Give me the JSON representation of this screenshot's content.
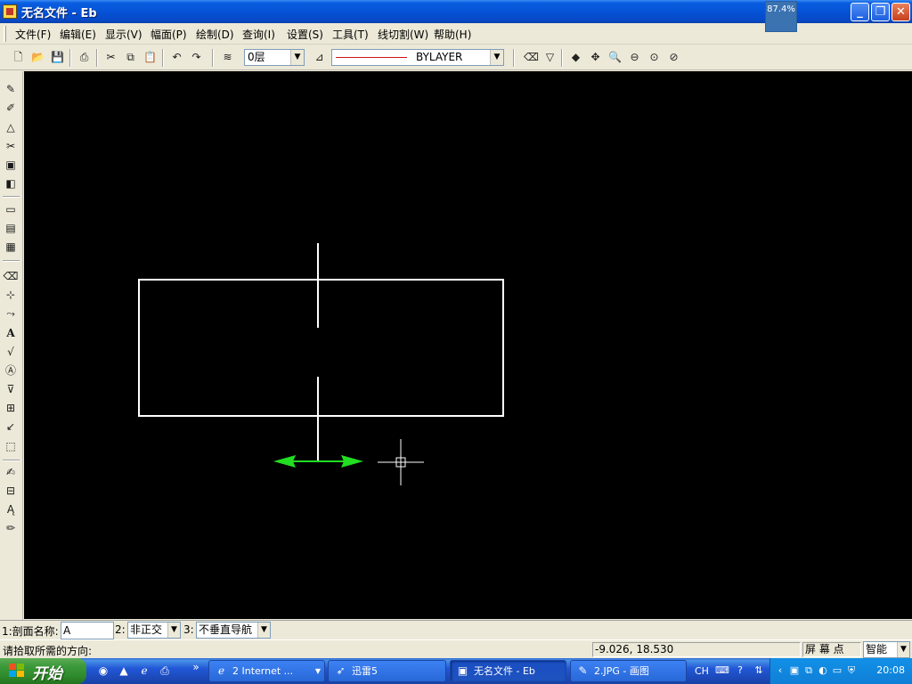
{
  "window": {
    "title": "无名文件 - Eb",
    "zoom_overlay": "87.4%"
  },
  "menu": [
    {
      "label": "文件(F)"
    },
    {
      "label": "编辑(E)"
    },
    {
      "label": "显示(V)"
    },
    {
      "label": "幅面(P)"
    },
    {
      "label": "绘制(D)"
    },
    {
      "label": "查询(I)"
    },
    {
      "label": "设置(S)"
    },
    {
      "label": "工具(T)"
    },
    {
      "label": "线切割(W)"
    },
    {
      "label": "帮助(H)"
    }
  ],
  "toolbar": {
    "layer_value": "0层",
    "linetype_value": "BYLAYER",
    "linetype_color": "#d01010"
  },
  "command": {
    "field1_label": "1:剖面名称:",
    "field1_value": "A",
    "field2_label": "2:",
    "field2_value": "非正交",
    "field3_label": "3:",
    "field3_value": "不垂直导航"
  },
  "status": {
    "prompt": "请拾取所需的方向:",
    "coordinates": "-9.026, 18.530",
    "snap_mode": "屏 幕 点",
    "smart_mode": "智能"
  },
  "canvas": {
    "background": "#000000",
    "line_color": "#ffffff",
    "arrow_color": "#22dd22"
  },
  "taskbar": {
    "start_label": "开始",
    "tasks": [
      {
        "label": "2 Internet ...",
        "icon": "internet-explorer-icon"
      },
      {
        "label": "迅雷5",
        "icon": "thunder-icon"
      },
      {
        "label": "无名文件 - Eb",
        "icon": "app-icon",
        "active": true
      },
      {
        "label": "2.JPG - 画图",
        "icon": "paint-icon"
      }
    ],
    "language": "CH",
    "clock": "20:08"
  }
}
